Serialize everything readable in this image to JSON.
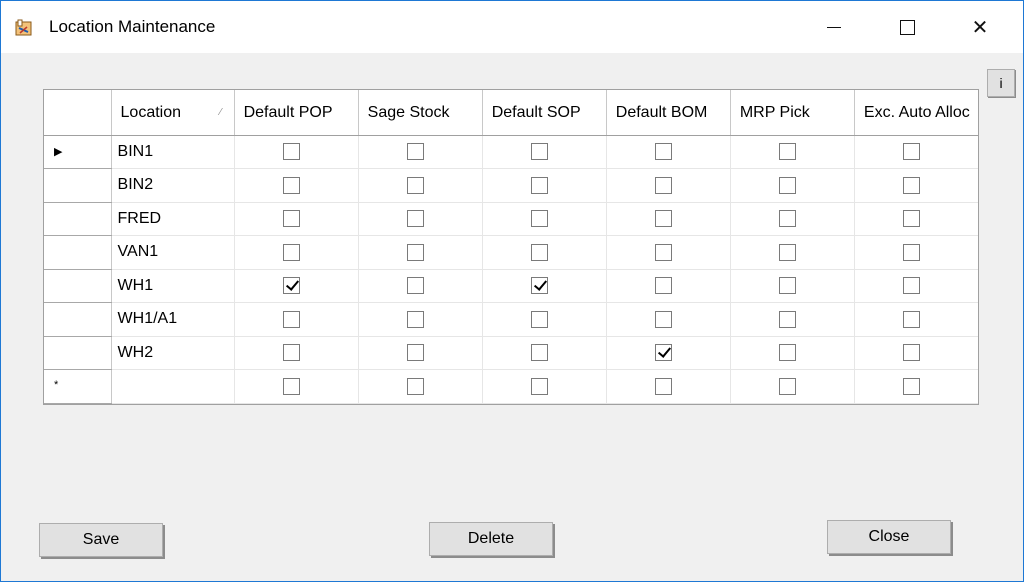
{
  "window": {
    "title": "Location Maintenance",
    "accent_color": "#1e78d4",
    "app_icon": "app-icon",
    "controls": {
      "minimize_icon": "minimize-icon",
      "maximize_icon": "maximize-icon",
      "close_glyph": "✕"
    }
  },
  "info_button": {
    "label": "i"
  },
  "grid": {
    "columns": [
      {
        "label": "Location",
        "sortable": true
      },
      {
        "label": "Default POP"
      },
      {
        "label": "Sage Stock"
      },
      {
        "label": "Default SOP"
      },
      {
        "label": "Default BOM"
      },
      {
        "label": "MRP Pick"
      },
      {
        "label": "Exc. Auto Alloc"
      }
    ],
    "sort_glyph": "⁄",
    "current_row_glyph": "▶",
    "new_row_glyph": "*",
    "rows": [
      {
        "location": "BIN1",
        "flags": [
          false,
          false,
          false,
          false,
          false,
          false
        ],
        "current": true
      },
      {
        "location": "BIN2",
        "flags": [
          false,
          false,
          false,
          false,
          false,
          false
        ]
      },
      {
        "location": "FRED",
        "flags": [
          false,
          false,
          false,
          false,
          false,
          false
        ]
      },
      {
        "location": "VAN1",
        "flags": [
          false,
          false,
          false,
          false,
          false,
          false
        ]
      },
      {
        "location": "WH1",
        "flags": [
          true,
          false,
          true,
          false,
          false,
          false
        ]
      },
      {
        "location": "WH1/A1",
        "flags": [
          false,
          false,
          false,
          false,
          false,
          false
        ]
      },
      {
        "location": "WH2",
        "flags": [
          false,
          false,
          false,
          true,
          false,
          false
        ]
      },
      {
        "location": "",
        "flags": [
          false,
          false,
          false,
          false,
          false,
          false
        ],
        "new_row": true
      }
    ]
  },
  "buttons": {
    "save": "Save",
    "delete": "Delete",
    "close": "Close"
  }
}
